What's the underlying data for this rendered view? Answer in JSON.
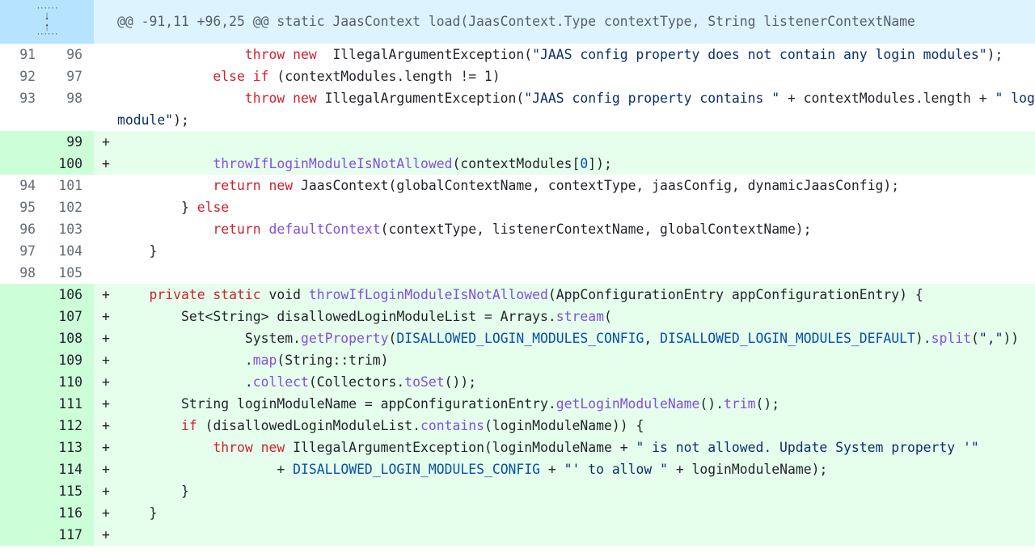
{
  "hunk": {
    "header": "@@ -91,11 +96,25 @@ static JaasContext load(JaasContext.Type contextType, String listenerContextName",
    "expand_down_icon": "arrow-down",
    "expand_up_icon": "arrow-up"
  },
  "colors": {
    "keyword": "#cf222e",
    "function": "#8250df",
    "constant": "#0550ae",
    "string": "#0a3069",
    "added_bg": "#e6ffec",
    "added_num_bg": "#ccffd8",
    "hunk_bg": "#ddf4ff"
  },
  "lines": [
    {
      "old": "91",
      "new": "96",
      "type": "ctx",
      "indent": "                ",
      "tokens": [
        [
          "kw",
          "throw new"
        ],
        [
          "",
          "  IllegalArgumentException("
        ],
        [
          "str",
          "\"JAAS config property does not contain any login modules\""
        ],
        [
          "",
          ");"
        ]
      ]
    },
    {
      "old": "92",
      "new": "97",
      "type": "ctx",
      "indent": "            ",
      "tokens": [
        [
          "kw",
          "else if"
        ],
        [
          "",
          " (contextModules.length != 1)"
        ]
      ]
    },
    {
      "old": "93",
      "new": "98",
      "type": "ctx",
      "indent": "                ",
      "tokens": [
        [
          "kw",
          "throw new"
        ],
        [
          "",
          " IllegalArgumentException("
        ],
        [
          "str",
          "\"JAAS config property contains \""
        ],
        [
          "",
          " + contextModules.length + "
        ],
        [
          "str",
          "\" login"
        ]
      ],
      "wrap": [
        [
          "str",
          "module\""
        ],
        [
          "",
          ");"
        ]
      ]
    },
    {
      "old": "",
      "new": "99",
      "type": "add",
      "indent": "",
      "tokens": []
    },
    {
      "old": "",
      "new": "100",
      "type": "add",
      "indent": "            ",
      "tokens": [
        [
          "fn",
          "throwIfLoginModuleIsNotAllowed"
        ],
        [
          "",
          "(contextModules["
        ],
        [
          "cn",
          "0"
        ],
        [
          "",
          "]);"
        ]
      ]
    },
    {
      "old": "94",
      "new": "101",
      "type": "ctx",
      "indent": "            ",
      "tokens": [
        [
          "kw",
          "return new"
        ],
        [
          "",
          " JaasContext(globalContextName, contextType, jaasConfig, dynamicJaasConfig);"
        ]
      ]
    },
    {
      "old": "95",
      "new": "102",
      "type": "ctx",
      "indent": "        ",
      "tokens": [
        [
          "",
          "} "
        ],
        [
          "kw",
          "else"
        ]
      ]
    },
    {
      "old": "96",
      "new": "103",
      "type": "ctx",
      "indent": "            ",
      "tokens": [
        [
          "kw",
          "return"
        ],
        [
          "",
          " "
        ],
        [
          "fn",
          "defaultContext"
        ],
        [
          "",
          "(contextType, listenerContextName, globalContextName);"
        ]
      ]
    },
    {
      "old": "97",
      "new": "104",
      "type": "ctx",
      "indent": "    ",
      "tokens": [
        [
          "",
          "}"
        ]
      ]
    },
    {
      "old": "98",
      "new": "105",
      "type": "ctx",
      "indent": "",
      "tokens": []
    },
    {
      "old": "",
      "new": "106",
      "type": "add",
      "indent": "    ",
      "tokens": [
        [
          "kw",
          "private static"
        ],
        [
          "",
          " void "
        ],
        [
          "fn",
          "throwIfLoginModuleIsNotAllowed"
        ],
        [
          "",
          "(AppConfigurationEntry appConfigurationEntry) {"
        ]
      ]
    },
    {
      "old": "",
      "new": "107",
      "type": "add",
      "indent": "        ",
      "tokens": [
        [
          "",
          "Set<String> disallowedLoginModuleList = Arrays."
        ],
        [
          "fn",
          "stream"
        ],
        [
          "",
          "("
        ]
      ]
    },
    {
      "old": "",
      "new": "108",
      "type": "add",
      "indent": "                ",
      "tokens": [
        [
          "",
          "System."
        ],
        [
          "fn",
          "getProperty"
        ],
        [
          "",
          "("
        ],
        [
          "cn",
          "DISALLOWED_LOGIN_MODULES_CONFIG"
        ],
        [
          "",
          ", "
        ],
        [
          "cn",
          "DISALLOWED_LOGIN_MODULES_DEFAULT"
        ],
        [
          "",
          ")."
        ],
        [
          "fn",
          "split"
        ],
        [
          "",
          "("
        ],
        [
          "str",
          "\",\""
        ],
        [
          "",
          "))"
        ]
      ]
    },
    {
      "old": "",
      "new": "109",
      "type": "add",
      "indent": "                ",
      "tokens": [
        [
          "",
          "."
        ],
        [
          "fn",
          "map"
        ],
        [
          "",
          "(String::trim)"
        ]
      ]
    },
    {
      "old": "",
      "new": "110",
      "type": "add",
      "indent": "                ",
      "tokens": [
        [
          "",
          "."
        ],
        [
          "fn",
          "collect"
        ],
        [
          "",
          "(Collectors."
        ],
        [
          "fn",
          "toSet"
        ],
        [
          "",
          "());"
        ]
      ]
    },
    {
      "old": "",
      "new": "111",
      "type": "add",
      "indent": "        ",
      "tokens": [
        [
          "",
          "String loginModuleName = appConfigurationEntry."
        ],
        [
          "fn",
          "getLoginModuleName"
        ],
        [
          "",
          "()."
        ],
        [
          "fn",
          "trim"
        ],
        [
          "",
          "();"
        ]
      ]
    },
    {
      "old": "",
      "new": "112",
      "type": "add",
      "indent": "        ",
      "tokens": [
        [
          "kw",
          "if"
        ],
        [
          "",
          " (disallowedLoginModuleList."
        ],
        [
          "fn",
          "contains"
        ],
        [
          "",
          "(loginModuleName)) {"
        ]
      ]
    },
    {
      "old": "",
      "new": "113",
      "type": "add",
      "indent": "            ",
      "tokens": [
        [
          "kw",
          "throw new"
        ],
        [
          "",
          " IllegalArgumentException(loginModuleName + "
        ],
        [
          "str",
          "\" is not allowed. Update System property '\""
        ]
      ]
    },
    {
      "old": "",
      "new": "114",
      "type": "add",
      "indent": "                    ",
      "tokens": [
        [
          "",
          "+ "
        ],
        [
          "cn",
          "DISALLOWED_LOGIN_MODULES_CONFIG"
        ],
        [
          "",
          " + "
        ],
        [
          "str",
          "\"' to allow \""
        ],
        [
          "",
          " + loginModuleName);"
        ]
      ]
    },
    {
      "old": "",
      "new": "115",
      "type": "add",
      "indent": "        ",
      "tokens": [
        [
          "",
          "}"
        ]
      ]
    },
    {
      "old": "",
      "new": "116",
      "type": "add",
      "indent": "    ",
      "tokens": [
        [
          "",
          "}"
        ]
      ]
    },
    {
      "old": "",
      "new": "117",
      "type": "add",
      "indent": "",
      "tokens": []
    }
  ],
  "add_marker": "+"
}
